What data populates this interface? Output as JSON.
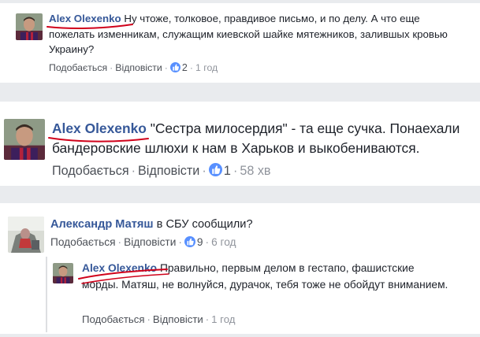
{
  "labels": {
    "like": "Подобається",
    "reply": "Відповісти",
    "separator": "·"
  },
  "comments": [
    {
      "author": "Alex Olexenko",
      "text": "Ну чтоже, толковое, правдивое письмо, и по делу. А что еще пожелать изменникам, служащим киевской шайке мятежников, залившых кровью Украину?",
      "likes": "2",
      "time": "1 год"
    },
    {
      "author": "Alex Olexenko",
      "text": "\"Сестра милосердия\" - та еще сучка. Понаехали бандеровские шлюхи к нам в Харьков и выкобениваются.",
      "likes": "1",
      "time": "58 хв"
    },
    {
      "author": "Александр Матяш",
      "text": "в СБУ сообщили?",
      "likes": "9",
      "time": "6 год"
    },
    {
      "author": "Alex Olexenko",
      "text": "Правильно, первым делом в гестапо, фашистские морды. Матяш, не волнуйся, дурачок, тебя тоже не обойдут вниманием.",
      "time": "1 год"
    }
  ],
  "colors": {
    "author": "#365899",
    "link": "#4b4f56",
    "meta": "#90949c",
    "like_badge": "#5890ff",
    "annotation": "#d0021b",
    "separator": "#e9ebee"
  },
  "icons": {
    "avatar": "user-avatar",
    "like_badge": "thumbs-up-icon"
  }
}
